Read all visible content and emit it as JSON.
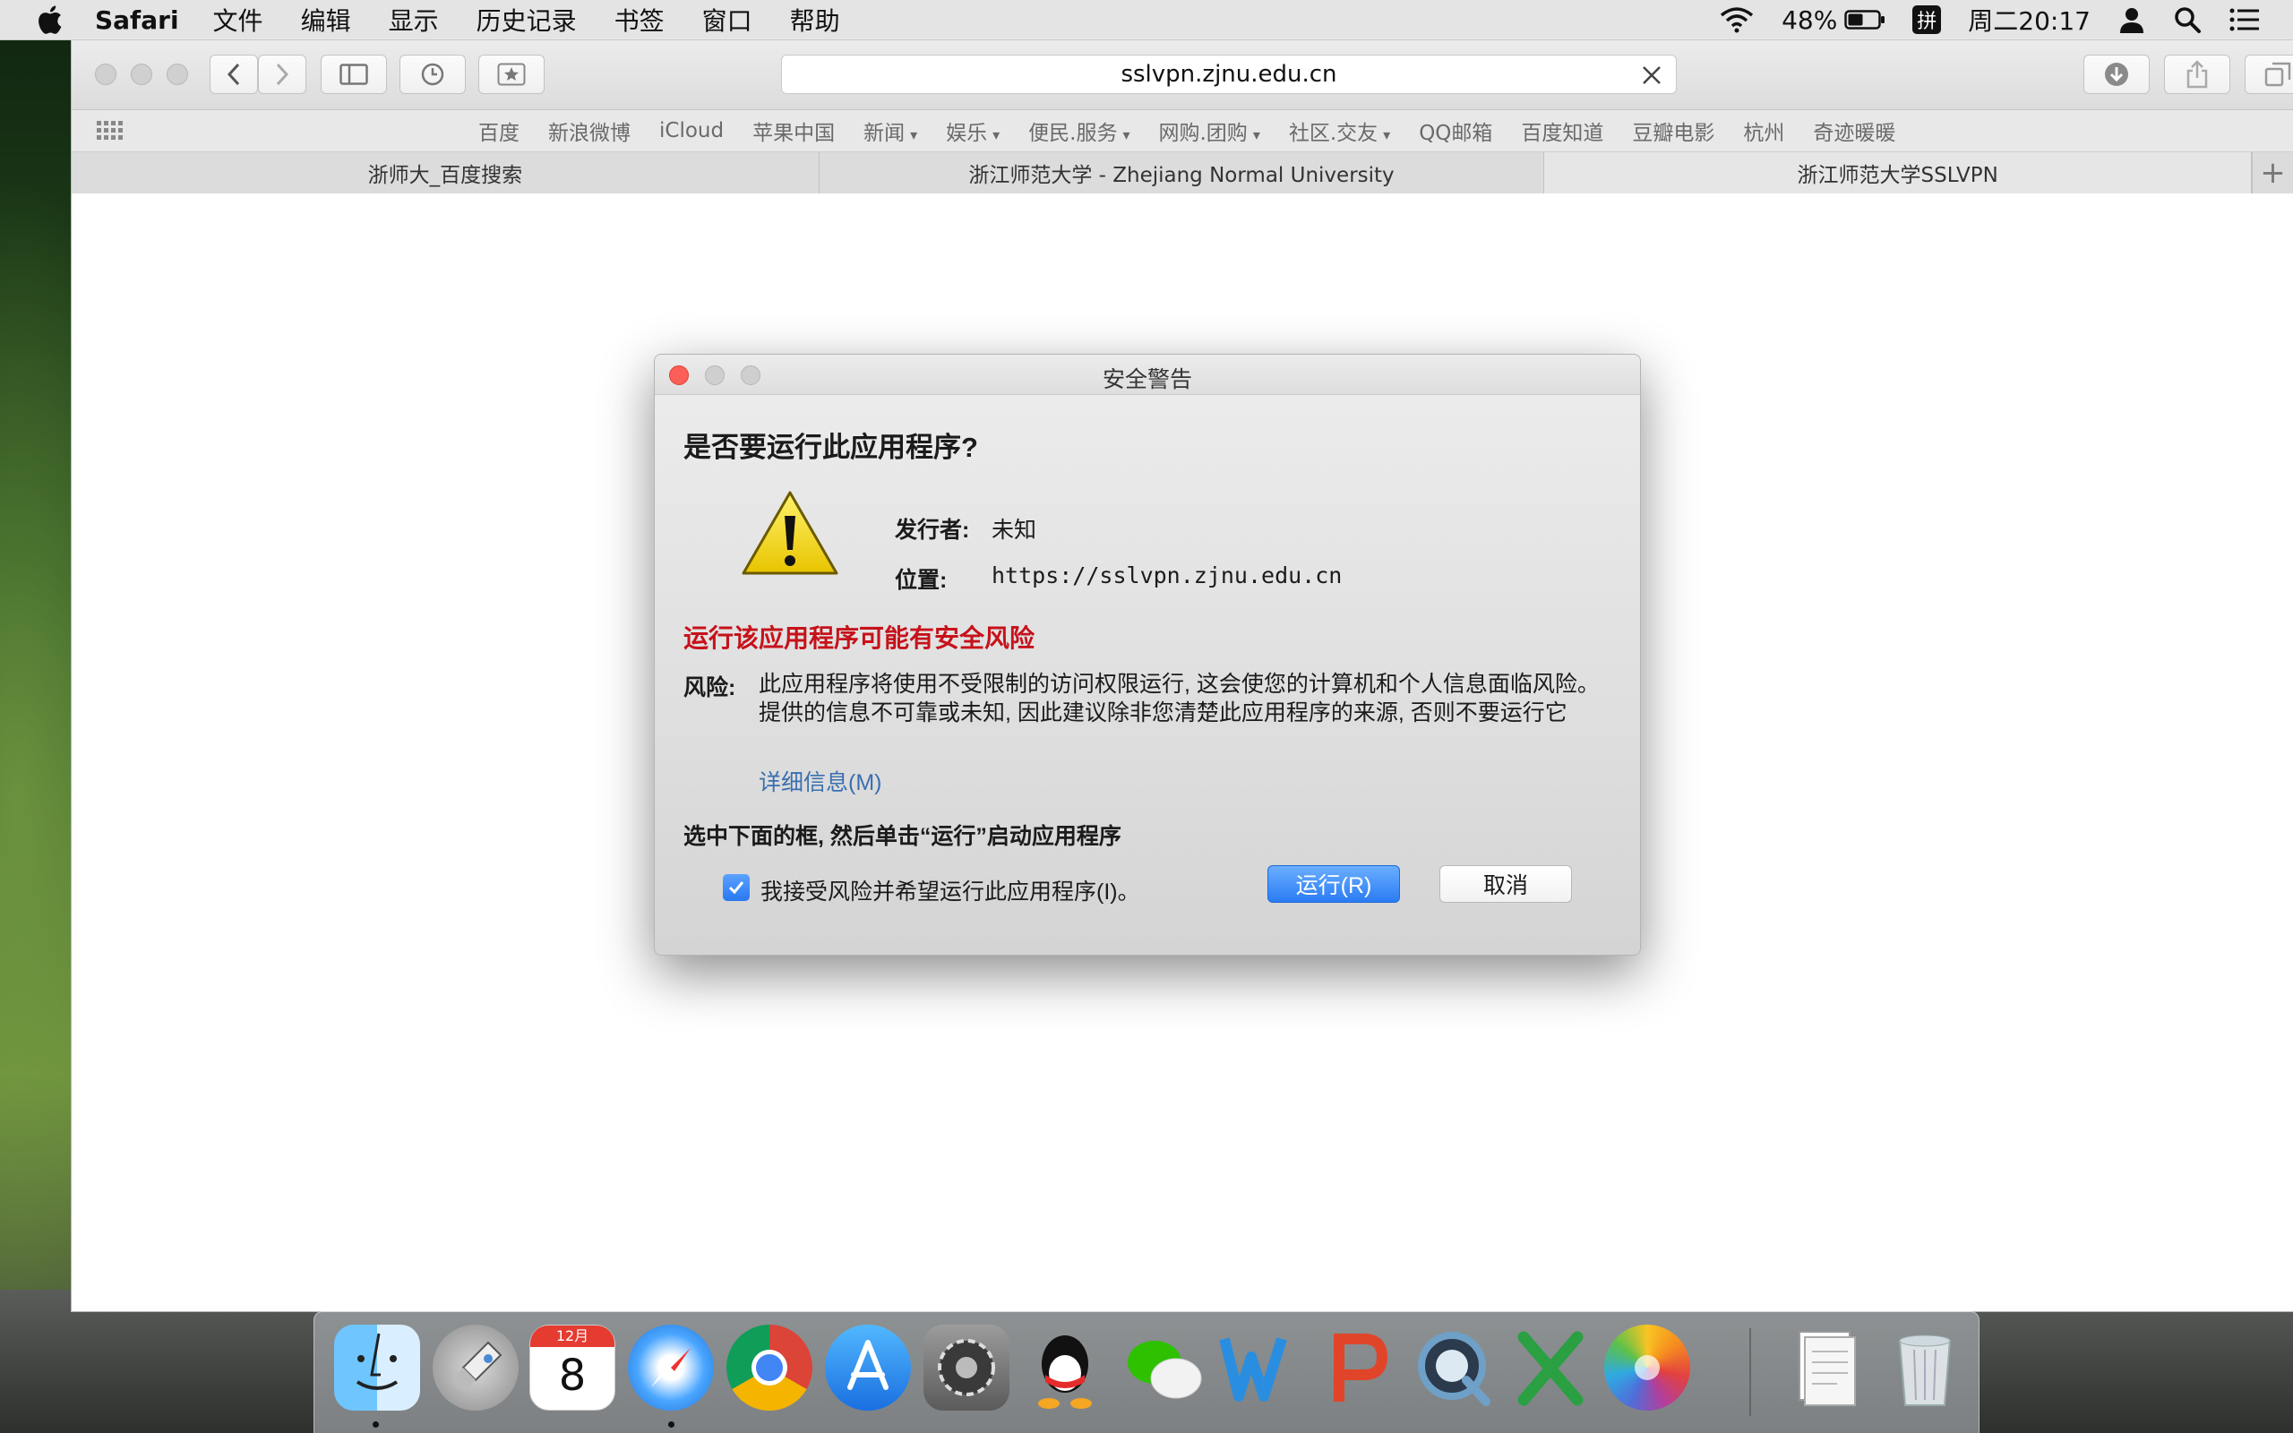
{
  "menubar": {
    "app_name": "Safari",
    "menus": [
      "文件",
      "编辑",
      "显示",
      "历史记录",
      "书签",
      "窗口",
      "帮助"
    ],
    "battery_percent": "48%",
    "input_method": "拼",
    "clock": "周二20:17"
  },
  "browser": {
    "url": "sslvpn.zjnu.edu.cn",
    "favorites": [
      {
        "label": "百度",
        "has_menu": false
      },
      {
        "label": "新浪微博",
        "has_menu": false
      },
      {
        "label": "iCloud",
        "has_menu": false
      },
      {
        "label": "苹果中国",
        "has_menu": false
      },
      {
        "label": "新闻",
        "has_menu": true
      },
      {
        "label": "娱乐",
        "has_menu": true
      },
      {
        "label": "便民.服务",
        "has_menu": true
      },
      {
        "label": "网购.团购",
        "has_menu": true
      },
      {
        "label": "社区.交友",
        "has_menu": true
      },
      {
        "label": "QQ邮箱",
        "has_menu": false
      },
      {
        "label": "百度知道",
        "has_menu": false
      },
      {
        "label": "豆瓣电影",
        "has_menu": false
      },
      {
        "label": "杭州",
        "has_menu": false
      },
      {
        "label": "奇迹暖暖",
        "has_menu": false
      }
    ],
    "tabs": [
      {
        "label": "浙师大_百度搜索",
        "active": false
      },
      {
        "label": "浙江师范大学 - Zhejiang Normal University",
        "active": false
      },
      {
        "label": "浙江师范大学SSLVPN",
        "active": true
      }
    ]
  },
  "dialog": {
    "title": "安全警告",
    "heading": "是否要运行此应用程序?",
    "publisher_label": "发行者:",
    "publisher_value": "未知",
    "location_label": "位置:",
    "location_value": "https://sslvpn.zjnu.edu.cn",
    "risk_title": "运行该应用程序可能有安全风险",
    "risk_label": "风险:",
    "risk_text": "此应用程序将使用不受限制的访问权限运行, 这会使您的计算机和个人信息面临风险。提供的信息不可靠或未知, 因此建议除非您清楚此应用程序的来源, 否则不要运行它",
    "more_info": "详细信息(M)",
    "instruction": "选中下面的框, 然后单击“运行”启动应用程序",
    "accept_label": "我接受风险并希望运行此应用程序(I)。",
    "accept_checked": true,
    "run_label": "运行(R)",
    "cancel_label": "取消"
  },
  "dock": {
    "apps": [
      "finder",
      "launchpad",
      "calendar",
      "safari",
      "chrome",
      "app-store",
      "system-preferences",
      "qq",
      "wechat",
      "word",
      "powerpoint",
      "quicktime",
      "excel",
      "photos",
      "documents",
      "trash"
    ],
    "calendar_month": "12月",
    "calendar_day": "8",
    "running": [
      "finder",
      "safari"
    ]
  },
  "colors": {
    "risk_red": "#c6121b",
    "accent_blue": "#2a7cf3",
    "link_blue": "#3a6fb0"
  }
}
